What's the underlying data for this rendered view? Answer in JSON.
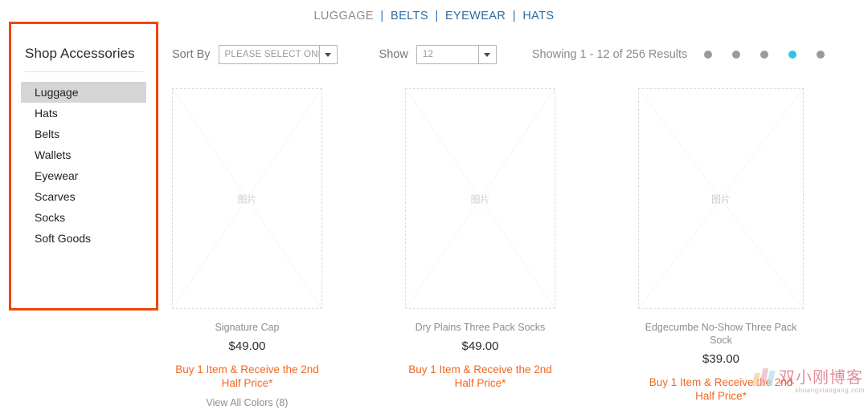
{
  "top_nav": {
    "separator": "|",
    "items": [
      {
        "label": "LUGGAGE",
        "state": "current"
      },
      {
        "label": "BELTS",
        "state": "link"
      },
      {
        "label": "EYEWEAR",
        "state": "link"
      },
      {
        "label": "HATS",
        "state": "link"
      }
    ]
  },
  "sidebar": {
    "title": "Shop Accessories",
    "border_color": "#f4440b",
    "active_background": "#d5d5d5",
    "items": [
      {
        "label": "Luggage",
        "active": true
      },
      {
        "label": "Hats",
        "active": false
      },
      {
        "label": "Belts",
        "active": false
      },
      {
        "label": "Wallets",
        "active": false
      },
      {
        "label": "Eyewear",
        "active": false
      },
      {
        "label": "Scarves",
        "active": false
      },
      {
        "label": "Socks",
        "active": false
      },
      {
        "label": "Soft Goods",
        "active": false
      }
    ]
  },
  "toolbar": {
    "sort_by_label": "Sort By",
    "sort_by_value": "PLEASE SELECT ONE",
    "show_label": "Show",
    "show_value": "12",
    "results_text": "Showing 1 - 12 of 256 Results",
    "pager": {
      "dots": 5,
      "active_index": 3,
      "active_color": "#2ec4e6",
      "inactive_color": "#9a9a9a"
    }
  },
  "products": [
    {
      "image_placeholder_text": "图片",
      "title": "Signature Cap",
      "price": "$49.00",
      "promo": "Buy 1 Item & Receive the 2nd Half Price*",
      "colors_link": "View All Colors (8)"
    },
    {
      "image_placeholder_text": "图片",
      "title": "Dry Plains Three Pack Socks",
      "price": "$49.00",
      "promo": "Buy 1 Item & Receive the 2nd Half Price*",
      "colors_link": ""
    },
    {
      "image_placeholder_text": "图片",
      "title": "Edgecumbe No-Show Three Pack Sock",
      "price": "$39.00",
      "promo": "Buy 1 Item & Receive the 2nd Half Price*",
      "colors_link": ""
    }
  ],
  "watermark": {
    "text_cn": "双小刚博客",
    "url": "shuangxiaogang.com"
  },
  "colors": {
    "promo_orange": "#f26722",
    "nav_link_blue": "#2b6ca3"
  }
}
